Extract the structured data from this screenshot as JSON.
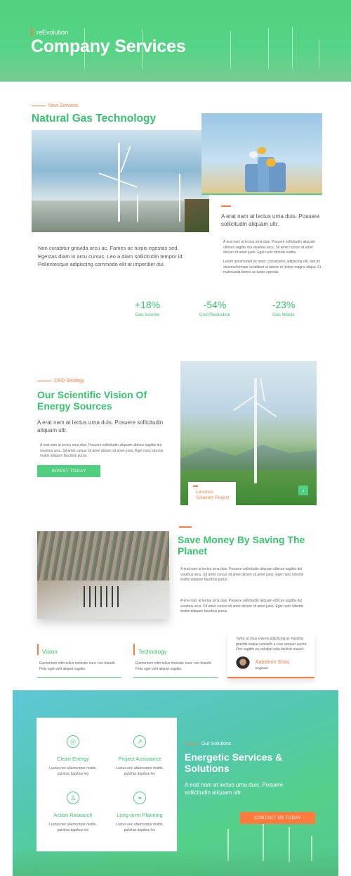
{
  "hero": {
    "overtitle": "reEvolution",
    "title": "Company Services"
  },
  "services": {
    "eyebrow": "New Services",
    "title": "Natural Gas Technology",
    "left_paragraph": "Non curabitur gravida arcu ac. Fames ac turpis egestas sed. Egestas diam in arcu cursus. Leo a diam sollicitudin tempor id. Pellentesque adipiscing commodo elit at imperdiet dui.",
    "right_lead": "A erat nam at lectus urna duis. Posuere sollicitudin aliquam ultr.",
    "right_small_1": "A erat nam at lectus urna duis. Posuere sollicitudin aliquam ultrices sagittis dui vivamus arcu. Sit amet cursus sit amet dictum sit amet justo. Eget nunc lobortis mattis.",
    "right_small_2": "Lorem ipsum dolor sit amet, consectetur adipiscing elit, sed do eiusmod tempor incididunt ut labore et dolore magna aliqua. Et malesuada fames ac turpis egestas.",
    "stats": [
      {
        "value": "+18%",
        "label": "Gas Income"
      },
      {
        "value": "-54%",
        "label": "Cost Reduction"
      },
      {
        "value": "-23%",
        "label": "Gas Waste"
      }
    ]
  },
  "vision": {
    "eyebrow": "CEO Strategy",
    "title": "Our Scientific Vision Of Energy Sources",
    "lead": "A erat nam at lectus urna duis. Posuere sollicitudin aliquam ultr.",
    "small": "A erat nam at lectus urna duis. Posuere sollicitudin aliquam ultrices sagittis dui vivamus arcu. Sit amet cursus sit amet dictum sit amet justo. Eget nunc lobortis mattis aliquam faucibus purus.",
    "button": "INVEST TODAY",
    "card_label": "Loremus Solarium Project",
    "arrow": "›"
  },
  "save": {
    "title": "Save Money By Saving The Planet",
    "para1": "A erat nam at lectus urna duis. Posuere sollicitudin aliquam ultrices sagittis dui vivamus arcu. Sit amet cursus sit amet dictum sit amet justo. Eget nunc lobortis mattis aliquam faucibus purus.",
    "para2": "A erat nam at lectus urna duis. Posuere sollicitudin aliquam ultrices sagittis dui vivamus arcu. Sit amet cursus sit amet dictum sit amet justo. Eget nunc lobortis mattis aliquam faucibus purus."
  },
  "features": [
    {
      "title": "Vision",
      "text": "Elementum nibh tellus molestie nunc non blandit. Felis eget velit aliquet sagittis."
    },
    {
      "title": "Technology",
      "text": "Elementum nibh tellus molestie nunc non blandit. Felis eget velit aliquet sagittis."
    }
  ],
  "testimonial": {
    "quote": "Tortor at risus viverra adipiscing at. Facilisis gravida neque convallis a cras semper auctor. Orci sagittis eu volutpat odio facilisis mauris.",
    "name": "Aabideen Shaq",
    "role": "Engineer"
  },
  "solutions": {
    "eyebrow": "Our Solutions",
    "title": "Energetic Services & Solutions",
    "lead": "A erat nam at lectus urna duis. Posuere sollicitudin aliquam ultr.",
    "button": "CONTACT US TODAY",
    "items": [
      {
        "icon": "lightbulb-icon",
        "glyph": "◎",
        "title": "Clean Energy",
        "text": "Luctus nec ullamcorper mattis, pulvinar dapibus leo"
      },
      {
        "icon": "chart-icon",
        "glyph": "↗",
        "title": "Project Assistance",
        "text": "Luctus nec ullamcorper mattis, pulvinar dapibus leo"
      },
      {
        "icon": "person-icon",
        "glyph": "♙",
        "title": "Action Research",
        "text": "Luctus nec ullamcorper mattis, pulvinar dapibus leo"
      },
      {
        "icon": "leaf-icon",
        "glyph": "❧",
        "title": "Long-term Planning",
        "text": "Luctus nec ullamcorper mattis, pulvinar dapibus leo"
      }
    ]
  },
  "colors": {
    "green": "#36c46d",
    "green_light": "#50cf80",
    "orange": "#ff7a3d"
  }
}
